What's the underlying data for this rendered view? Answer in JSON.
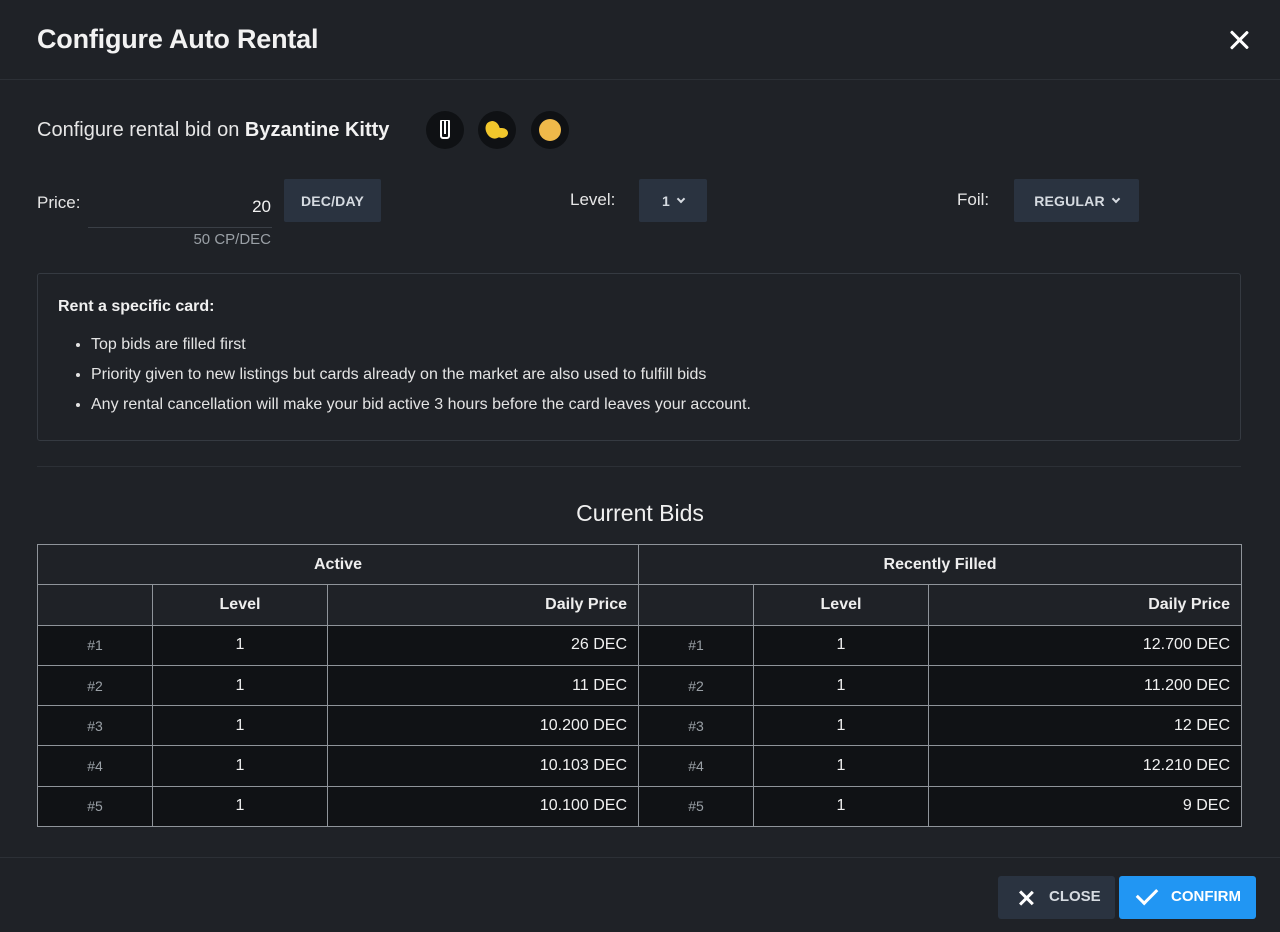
{
  "dialog": {
    "title": "Configure Auto Rental",
    "close_icon": "close-icon"
  },
  "subtitle": {
    "prefix": "Configure rental bid on",
    "card_name": "Byzantine Kitty",
    "badges": [
      "rarity-icon",
      "edition-icon",
      "element-icon"
    ]
  },
  "price": {
    "label": "Price:",
    "value": "20",
    "unit": "DEC/DAY",
    "conversion": "50 CP/DEC"
  },
  "level": {
    "label": "Level:",
    "value": "1"
  },
  "foil": {
    "label": "Foil:",
    "value": "REGULAR"
  },
  "info": {
    "title": "Rent a specific card:",
    "items": [
      "Top bids are filled first",
      "Priority given to new listings but cards already on the market are also used to fulfill bids",
      "Any rental cancellation will make your bid active 3 hours before the card leaves your account."
    ]
  },
  "bids": {
    "title": "Current Bids",
    "active_header": "Active",
    "filled_header": "Recently Filled",
    "columns": {
      "level": "Level",
      "price": "Daily Price"
    },
    "rows": [
      {
        "rank": "#1",
        "active_level": "1",
        "active_price": "26 DEC",
        "filled_rank": "#1",
        "filled_level": "1",
        "filled_price": "12.700 DEC"
      },
      {
        "rank": "#2",
        "active_level": "1",
        "active_price": "11 DEC",
        "filled_rank": "#2",
        "filled_level": "1",
        "filled_price": "11.200 DEC"
      },
      {
        "rank": "#3",
        "active_level": "1",
        "active_price": "10.200 DEC",
        "filled_rank": "#3",
        "filled_level": "1",
        "filled_price": "12 DEC"
      },
      {
        "rank": "#4",
        "active_level": "1",
        "active_price": "10.103 DEC",
        "filled_rank": "#4",
        "filled_level": "1",
        "filled_price": "12.210 DEC"
      },
      {
        "rank": "#5",
        "active_level": "1",
        "active_price": "10.100 DEC",
        "filled_rank": "#5",
        "filled_level": "1",
        "filled_price": "9 DEC"
      }
    ]
  },
  "footer": {
    "close_label": "CLOSE",
    "confirm_label": "CONFIRM"
  },
  "colors": {
    "background": "#1f2227",
    "table_cell": "#101215",
    "dark_button": "#2a3340",
    "confirm_button": "#2196f3",
    "accent_yellow": "#f2c72c",
    "accent_orange": "#f0b94a"
  }
}
